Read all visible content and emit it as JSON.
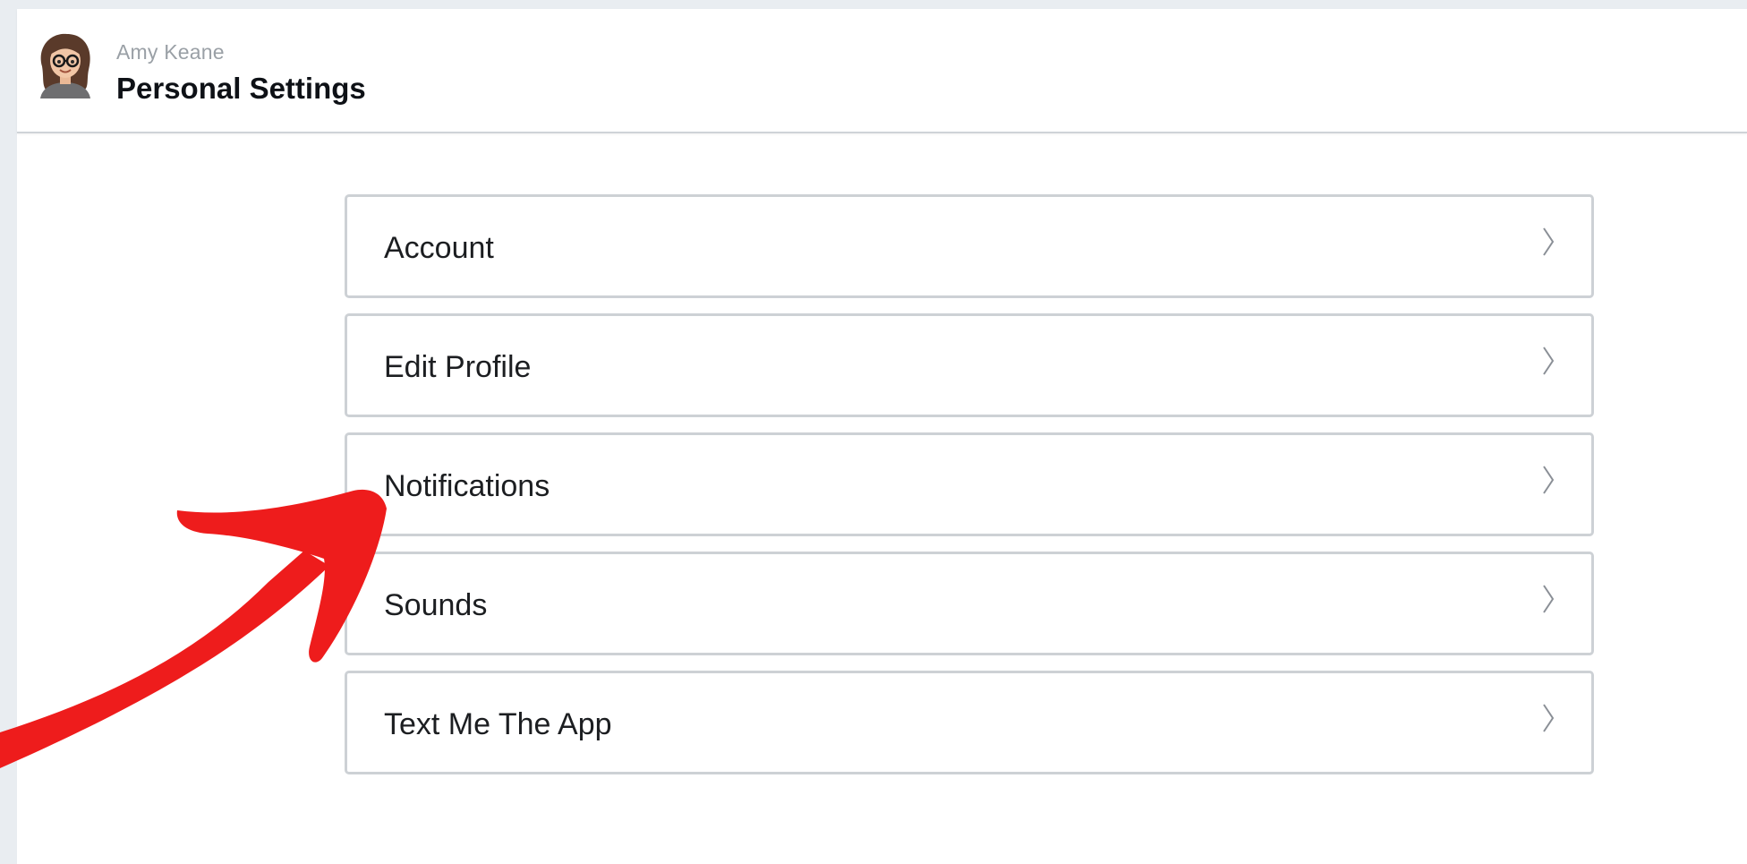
{
  "header": {
    "user_name": "Amy Keane",
    "title": "Personal Settings"
  },
  "menu": {
    "items": [
      {
        "label": "Account"
      },
      {
        "label": "Edit Profile"
      },
      {
        "label": "Notifications"
      },
      {
        "label": "Sounds"
      },
      {
        "label": "Text Me The App"
      }
    ]
  },
  "annotation": {
    "arrow_color": "#ee1c1c",
    "points_to": "Notifications"
  },
  "icons": {
    "avatar": "avatar-icon",
    "chevron": "chevron-right-icon"
  }
}
